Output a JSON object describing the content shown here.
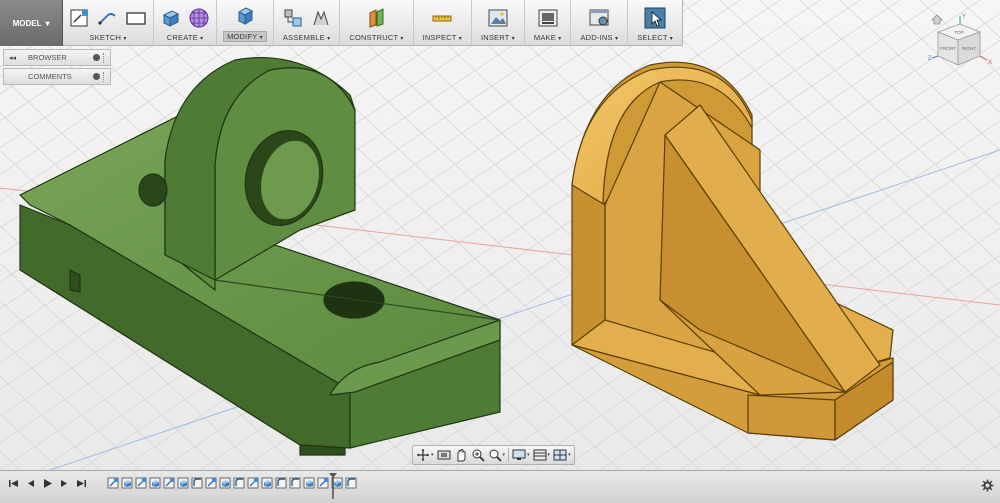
{
  "toolbar": {
    "workspace_label": "MODEL",
    "groups": {
      "sketch": "SKETCH",
      "create": "CREATE",
      "modify": "MODIFY",
      "assemble": "ASSEMBLE",
      "construct": "CONSTRUCT",
      "inspect": "INSPECT",
      "insert": "INSERT",
      "make": "MAKE",
      "addins": "ADD-INS",
      "select": "SELECT"
    },
    "active_group": "modify"
  },
  "panels": {
    "browser": "BROWSER",
    "comments": "COMMENTS"
  },
  "viewcube": {
    "faces": {
      "top": "TOP",
      "front": "FRONT",
      "right": "RIGHT"
    },
    "axes": {
      "x": "X",
      "y": "Y",
      "z": "Z"
    }
  },
  "navigation": {
    "tools": [
      "orbit-icon",
      "look-at-icon",
      "pan-icon",
      "zoom-icon",
      "zoom-window-icon",
      "display-settings-icon",
      "grid-icon",
      "viewports-icon"
    ]
  },
  "timeline": {
    "features": [
      "sketch",
      "extrude",
      "sketch",
      "extrude",
      "sketch",
      "extrude",
      "fillet",
      "sketch",
      "extrude",
      "fillet",
      "sketch",
      "extrude",
      "fillet",
      "fillet",
      "extrude",
      "sketch",
      "extrude",
      "fillet"
    ]
  },
  "colors": {
    "part_green": "#58843c",
    "part_orange": "#e1a940",
    "toolbar_bg": "#e4e4e4",
    "workspace_bg": "#7a7a7a",
    "grid_line": "#d3d3d3",
    "axis_red": "#e08a8a",
    "axis_blue": "#8aa8e0"
  }
}
